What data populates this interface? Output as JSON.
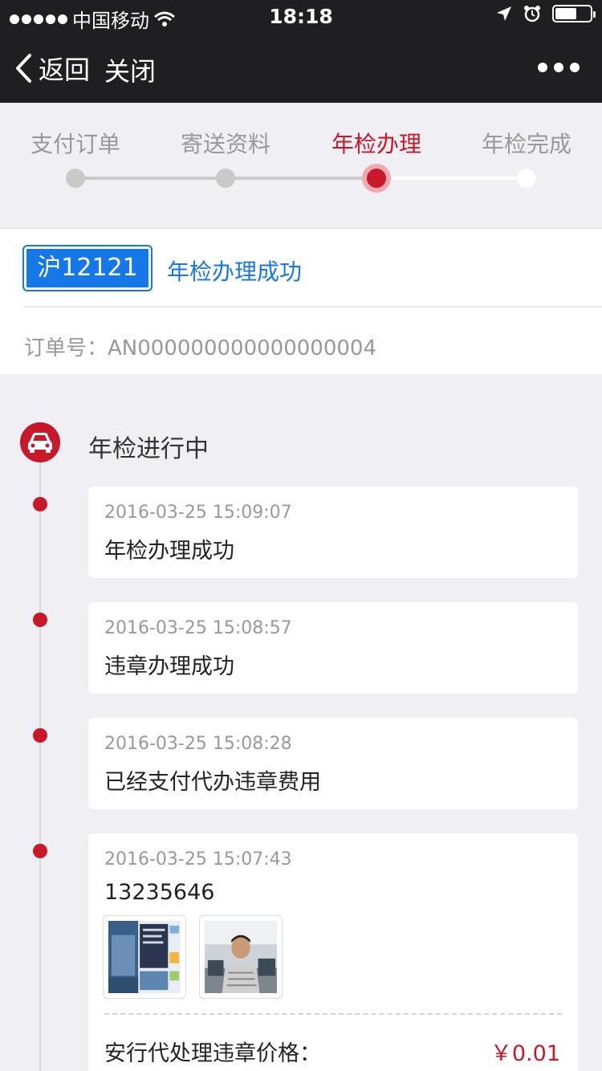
{
  "status_bar": {
    "carrier": "中国移动",
    "time": "18:18"
  },
  "nav": {
    "back_label": "返回",
    "close_label": "关闭"
  },
  "steps": [
    {
      "label": "支付订单"
    },
    {
      "label": "寄送资料"
    },
    {
      "label": "年检办理",
      "active": true
    },
    {
      "label": "年检完成"
    }
  ],
  "order": {
    "plate": "沪12121",
    "status": "年检办理成功",
    "order_no": "订单号：AN000000000000000004"
  },
  "timeline": {
    "title": "年检进行中",
    "events": [
      {
        "time": "2016-03-25 15:09:07",
        "text": "年检办理成功"
      },
      {
        "time": "2016-03-25 15:08:57",
        "text": "违章办理成功"
      },
      {
        "time": "2016-03-25 15:08:28",
        "text": "已经支付代办违章费用"
      },
      {
        "time": "2016-03-25 15:07:43",
        "text": "13235646",
        "price_label": "安行代处理违章价格：",
        "price_value": "￥0.01"
      }
    ]
  },
  "colors": {
    "accent_red": "#c8192b",
    "accent_blue": "#1677e8",
    "nav_bg": "#1f1f21"
  }
}
